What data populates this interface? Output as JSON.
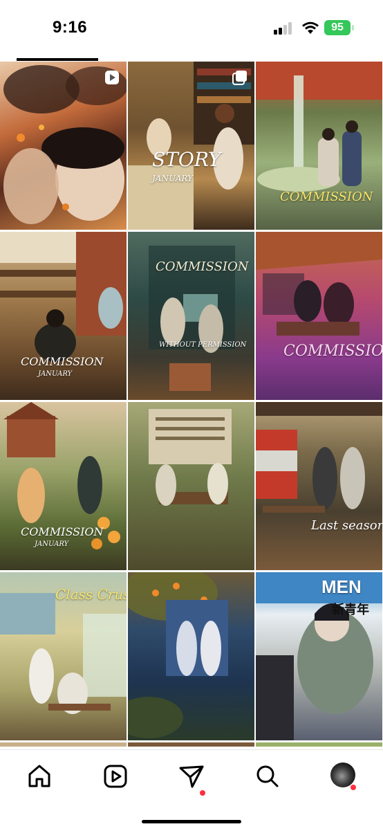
{
  "status": {
    "time": "9:16",
    "battery": "95"
  },
  "grid": {
    "tiles": [
      {
        "caption": ""
      },
      {
        "caption": "STORY",
        "sub": "JANUARY"
      },
      {
        "caption": "COMMISSION",
        "sub": ""
      },
      {
        "caption": "COMMISSION",
        "sub": "JANUARY"
      },
      {
        "caption": "COMMISSION",
        "sub": "WITHOUT PERMISSION"
      },
      {
        "caption": "COMMISSION",
        "sub": ""
      },
      {
        "caption": "COMMISSION",
        "sub": "JANUARY"
      },
      {
        "caption": "",
        "sub": ""
      },
      {
        "caption": "Last season",
        "sub": ""
      },
      {
        "caption": "Class Crush",
        "sub": ""
      },
      {
        "caption": "",
        "sub": ""
      },
      {
        "caption": "MEN",
        "sub": "新青年"
      }
    ]
  },
  "colors": {
    "notification": "#ff3040",
    "battery": "#34c759"
  },
  "nav": {
    "items": [
      "home-icon",
      "reels-icon",
      "send-icon",
      "search-icon",
      "profile-avatar"
    ]
  }
}
